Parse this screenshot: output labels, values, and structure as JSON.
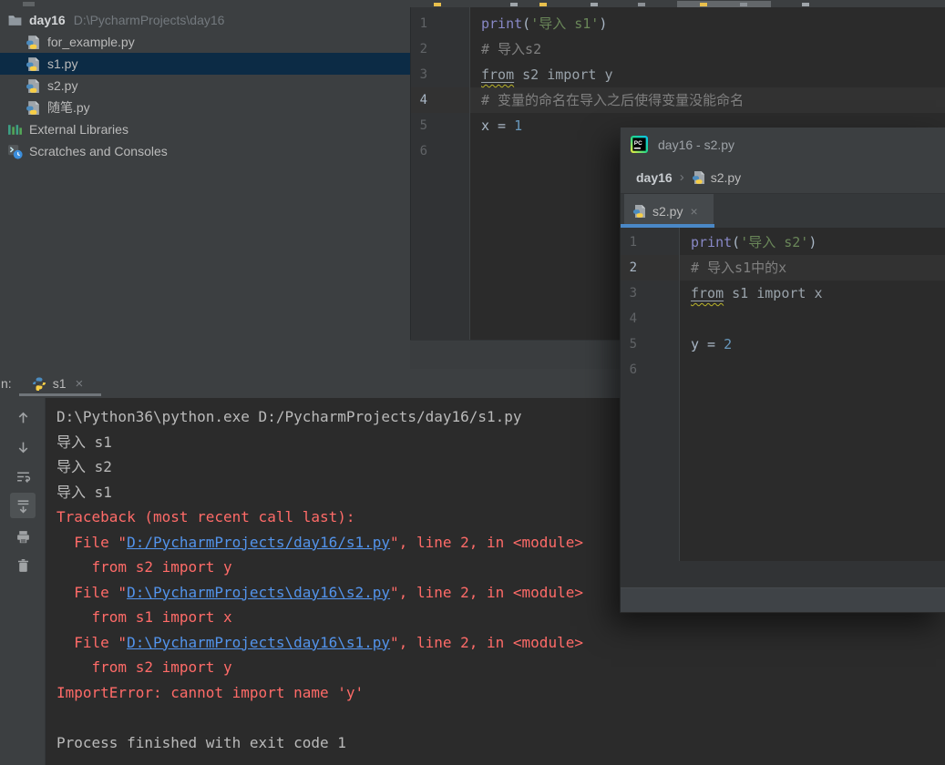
{
  "colors": {
    "panel_bg": "#3C3F41",
    "editor_bg": "#2B2B2B",
    "caret_row": "#323232",
    "tree_selection": "#0C2B45",
    "tab_underline_blue": "#4A88C7",
    "error_red": "#FF6B68",
    "link_blue": "#5394EC",
    "string_green": "#6A8759",
    "builtin_purple": "#8888C6",
    "number_blue": "#6897BB",
    "comment_gray": "#808080",
    "warning_wavy_yellow": "#BBB529"
  },
  "project_tree": {
    "items": [
      {
        "name": "tree-item-day16",
        "icon": "folder",
        "label": "day16",
        "bold": true,
        "path": "D:\\PycharmProjects\\day16",
        "indent": 0,
        "selected": false
      },
      {
        "name": "tree-item-for-example-py",
        "icon": "pyfile",
        "label": "for_example.py",
        "bold": false,
        "path": "",
        "indent": 1,
        "selected": false
      },
      {
        "name": "tree-item-s1-py",
        "icon": "pyfile",
        "label": "s1.py",
        "bold": false,
        "path": "",
        "indent": 1,
        "selected": true
      },
      {
        "name": "tree-item-s2-py",
        "icon": "pyfile",
        "label": "s2.py",
        "bold": false,
        "path": "",
        "indent": 1,
        "selected": false
      },
      {
        "name": "tree-item-suibi-py",
        "icon": "pyfile",
        "label": "随笔.py",
        "bold": false,
        "path": "",
        "indent": 1,
        "selected": false
      },
      {
        "name": "tree-item-external-libraries",
        "icon": "extlibs",
        "label": "External Libraries",
        "bold": false,
        "path": "",
        "indent": 0,
        "selected": false
      },
      {
        "name": "tree-item-scratches-consoles",
        "icon": "scratches",
        "label": "Scratches and Consoles",
        "bold": false,
        "path": "",
        "indent": 0,
        "selected": false
      }
    ]
  },
  "editor_main": {
    "gutter": {
      "numbers": [
        1,
        2,
        3,
        4,
        5,
        6
      ],
      "highlighted": 4
    },
    "lines": [
      {
        "hl": false,
        "segs": [
          [
            "b",
            "print"
          ],
          [
            "p",
            "("
          ],
          [
            "s",
            "'导入 s1'"
          ],
          [
            "p",
            ")"
          ]
        ]
      },
      {
        "hl": false,
        "segs": [
          [
            "c",
            "# 导入s2"
          ]
        ]
      },
      {
        "hl": false,
        "segs": [
          [
            "uf",
            "from"
          ],
          [
            "u",
            " s2 import y"
          ]
        ]
      },
      {
        "hl": true,
        "segs": [
          [
            "c",
            "# 变量的命名在导入之后使得变量没能命名"
          ]
        ]
      },
      {
        "hl": false,
        "segs": [
          [
            "p",
            "x"
          ],
          [
            "p",
            " = "
          ],
          [
            "n",
            "1"
          ]
        ]
      },
      {
        "hl": false,
        "segs": []
      }
    ]
  },
  "floating_window": {
    "title": "day16 - s2.py",
    "app_icon": "pycharm-logo",
    "breadcrumb": {
      "project": "day16",
      "chevron": "›",
      "file": "s2.py"
    },
    "tab": {
      "label": "s2.py",
      "close": "×"
    },
    "gutter": {
      "numbers": [
        1,
        2,
        3,
        4,
        5,
        6
      ],
      "highlighted": 2
    },
    "lines": [
      {
        "hl": false,
        "segs": [
          [
            "b",
            "print"
          ],
          [
            "p",
            "("
          ],
          [
            "s",
            "'导入 s2'"
          ],
          [
            "p",
            ")"
          ]
        ]
      },
      {
        "hl": true,
        "segs": [
          [
            "c",
            "# 导入s1中的x"
          ]
        ]
      },
      {
        "hl": false,
        "segs": [
          [
            "uf",
            "from"
          ],
          [
            "u",
            " s1 import x"
          ]
        ]
      },
      {
        "hl": false,
        "segs": []
      },
      {
        "hl": false,
        "segs": [
          [
            "p",
            "y"
          ],
          [
            "p",
            " = "
          ],
          [
            "n",
            "2"
          ]
        ]
      },
      {
        "hl": false,
        "segs": []
      }
    ]
  },
  "console": {
    "header": {
      "prefix": "n:",
      "tab_label": "s1",
      "close": "×"
    },
    "toolbar": [
      {
        "name": "up-arrow-icon",
        "selected": false
      },
      {
        "name": "down-arrow-icon",
        "selected": false
      },
      {
        "name": "soft-wrap-icon",
        "selected": false
      },
      {
        "name": "scroll-to-end-icon",
        "selected": true
      },
      {
        "name": "print-icon",
        "selected": false
      },
      {
        "name": "clear-all-icon",
        "selected": false
      }
    ],
    "lines": [
      {
        "segs": [
          [
            "o",
            "D:\\Python36\\python.exe D:/PycharmProjects/day16/s1.py"
          ]
        ]
      },
      {
        "segs": [
          [
            "o",
            "导入 s1"
          ]
        ]
      },
      {
        "segs": [
          [
            "o",
            "导入 s2"
          ]
        ]
      },
      {
        "segs": [
          [
            "o",
            "导入 s1"
          ]
        ]
      },
      {
        "segs": [
          [
            "e",
            "Traceback (most recent call last):"
          ]
        ]
      },
      {
        "segs": [
          [
            "e",
            "  File \""
          ],
          [
            "l",
            "D:/PycharmProjects/day16/s1.py"
          ],
          [
            "e",
            "\", line 2, in <module>"
          ]
        ]
      },
      {
        "segs": [
          [
            "e",
            "    from s2 import y"
          ]
        ]
      },
      {
        "segs": [
          [
            "e",
            "  File \""
          ],
          [
            "l",
            "D:\\PycharmProjects\\day16\\s2.py"
          ],
          [
            "e",
            "\", line 2, in <module>"
          ]
        ]
      },
      {
        "segs": [
          [
            "e",
            "    from s1 import x"
          ]
        ]
      },
      {
        "segs": [
          [
            "e",
            "  File \""
          ],
          [
            "l",
            "D:\\PycharmProjects\\day16\\s1.py"
          ],
          [
            "e",
            "\", line 2, in <module>"
          ]
        ]
      },
      {
        "segs": [
          [
            "e",
            "    from s2 import y"
          ]
        ]
      },
      {
        "segs": [
          [
            "e",
            "ImportError: cannot import name 'y'"
          ]
        ]
      },
      {
        "segs": []
      },
      {
        "segs": [
          [
            "o",
            "Process finished with exit code 1"
          ]
        ]
      }
    ]
  }
}
